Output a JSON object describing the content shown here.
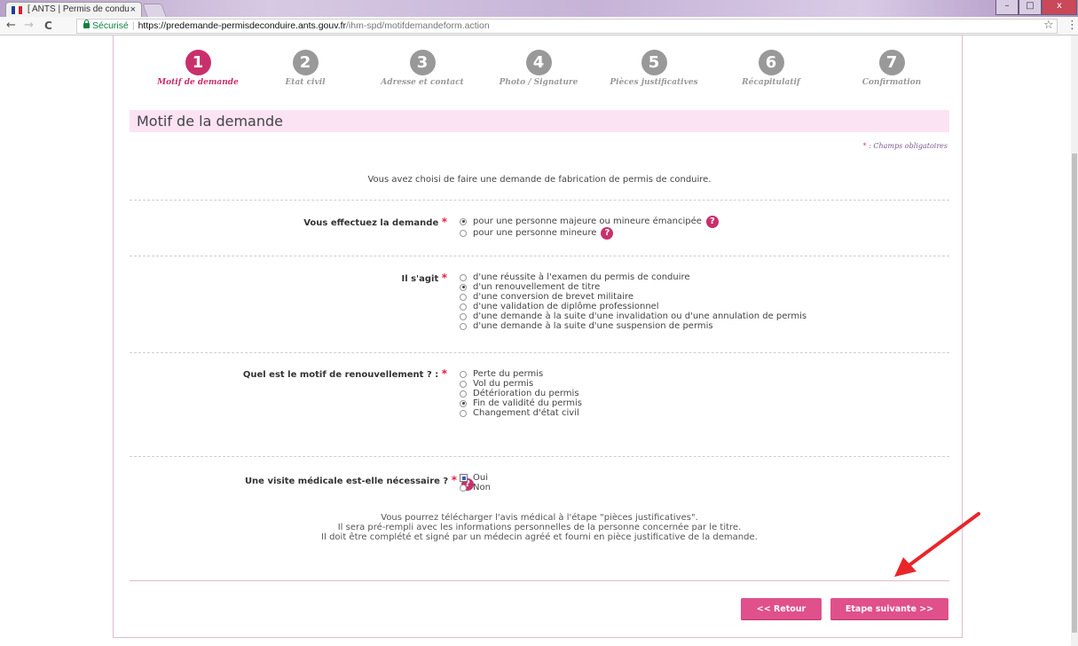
{
  "browser": {
    "tab_title": "[ ANTS | Permis de condu",
    "tab_close": "×",
    "window_minimize": "–",
    "window_restore": "□",
    "window_close": "x",
    "back": "←",
    "forward": "→",
    "reload": "C",
    "secure_label": "Sécurisé",
    "url_host": "https://predemande-permisdeconduire.ants.gouv.fr",
    "url_path": "/ihm-spd/motifdemandeform.action",
    "bookmark": "☆",
    "menu": "⋮"
  },
  "steps": [
    {
      "num": "1",
      "label": "Motif de demande",
      "active": true
    },
    {
      "num": "2",
      "label": "Etat civil",
      "active": false
    },
    {
      "num": "3",
      "label": "Adresse et contact",
      "active": false
    },
    {
      "num": "4",
      "label": "Photo / Signature",
      "active": false
    },
    {
      "num": "5",
      "label": "Pièces justificatives",
      "active": false
    },
    {
      "num": "6",
      "label": "Récapitulatif",
      "active": false
    },
    {
      "num": "7",
      "label": "Confirmation",
      "active": false
    }
  ],
  "form": {
    "title": "Motif de la demande",
    "required_note_star": "*",
    "required_note": " : Champs obligatoires",
    "intro": "Vous avez choisi de faire une demande de fabrication de permis de conduire.",
    "required_star": "*",
    "help": "?",
    "q1": {
      "label": "Vous effectuez la demande",
      "options": [
        "pour une personne majeure ou mineure émancipée",
        "pour une personne mineure"
      ],
      "selected": 0
    },
    "q2": {
      "label": "Il s'agit",
      "options": [
        "d'une réussite à l'examen du permis de conduire",
        "d'un renouvellement de titre",
        "d'une conversion de brevet militaire",
        "d'une validation de diplôme professionnel",
        "d'une demande à la suite d'une invalidation ou d'une annulation de permis",
        "d'une demande à la suite d'une suspension de permis"
      ],
      "selected": 1
    },
    "q3": {
      "label": "Quel est le motif de renouvellement ? :",
      "options": [
        "Perte du permis",
        "Vol du permis",
        "Détérioration du permis",
        "Fin de validité du permis",
        "Changement d'état civil"
      ],
      "selected": 3
    },
    "q4": {
      "label": "Une visite médicale est-elle nécessaire ?",
      "options": [
        "Oui",
        "Non"
      ],
      "selected": 0
    },
    "info_lines": [
      "Vous pourrez télécharger l'avis médical à l'étape \"pièces justificatives\".",
      "Il sera pré-rempli avec les informations personnelles de la personne concernée par le titre.",
      "Il doit être complété et signé par un médecin agréé et fourni en pièce justificative de la demande."
    ],
    "back_button": "<< Retour",
    "next_button": "Etape suivante >>"
  },
  "colors": {
    "accent": "#c8306c",
    "button": "#e0508a",
    "title_bg": "#fbe3f4",
    "arrow": "#e8262a"
  }
}
